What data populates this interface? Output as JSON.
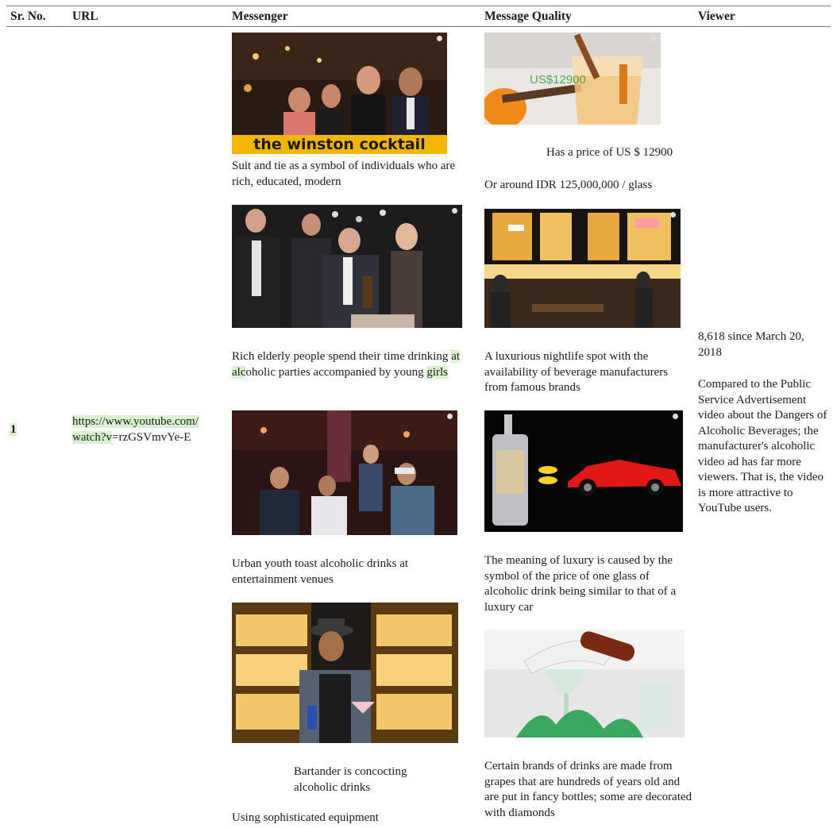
{
  "header": {
    "sr_no": "Sr. No.",
    "url": "URL",
    "messenger": "Messenger",
    "message_quality": "Message Quality",
    "viewer": "Viewer"
  },
  "row": {
    "sr_no": "1",
    "url_part1": "https://www.youtube.com/",
    "url_part2_hl": "watch?v",
    "url_part2_rest": "=rzGSVmvYe-E"
  },
  "messenger": {
    "image1_banner": "the winston cocktail",
    "caption1": "Suit and tie as a symbol of individuals who are rich, educated, modern",
    "caption2_a": "Rich elderly people spend their time drinking ",
    "caption2_hl1": "at alc",
    "caption2_b": "oholic parties accompanied by young ",
    "caption2_hl2": "girls",
    "caption3": "Urban youth toast alcoholic drinks at entertainment venues",
    "caption4": "Bartander is concocting alcoholic drinks",
    "caption5": "Using sophisticated equipment"
  },
  "quality": {
    "image1_overlay": "US$12900",
    "caption1_line1": "Has a price of US $ 12900",
    "caption1_line2": "Or around IDR 125,000,000 / glass",
    "caption2": "A luxurious nightlife spot with the availability of beverage manufacturers from famous brands",
    "caption3": "The meaning of luxury is caused by the symbol of the price of one glass of alcoholic drink being similar to that of a luxury car",
    "caption4": "Certain brands of drinks are made from grapes that are hundreds of years old and are put in fancy bottles; some are decorated with diamonds"
  },
  "viewer": {
    "count": "8,618 since March 20, 2018",
    "comparison": "Compared to the Public Service Advertisement video about the Dangers of Alcoholic Beverages; the manufacturer's alcoholic video ad has far more viewers. That is, the video is more attractive to YouTube users."
  },
  "colors": {
    "highlight": "#d9f2d0",
    "banner": "#f2b705"
  }
}
